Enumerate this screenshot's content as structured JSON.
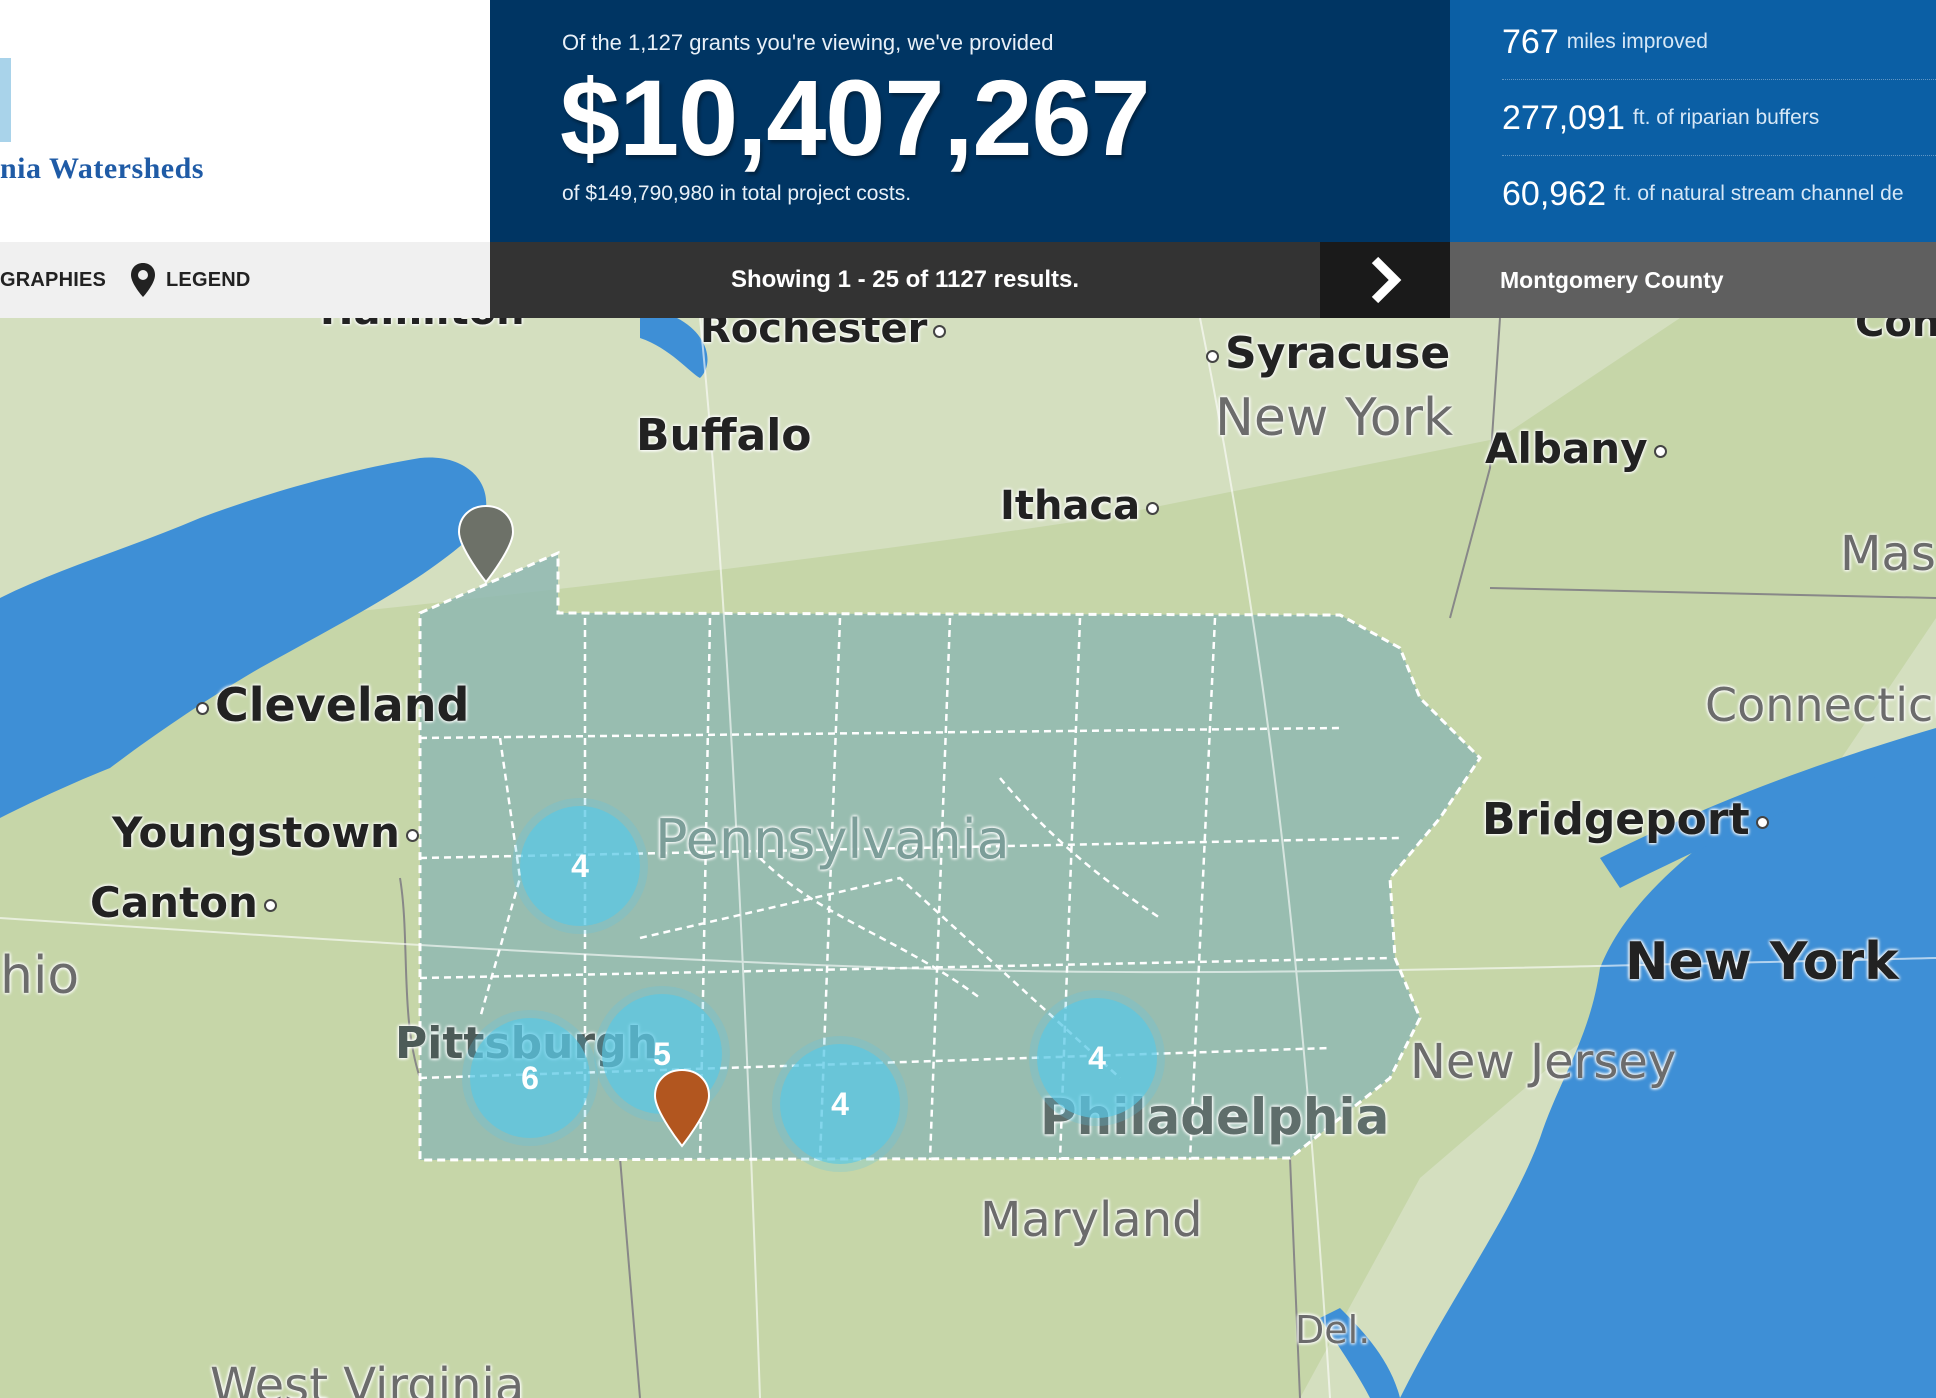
{
  "brand": {
    "logo_text": "nia Watersheds"
  },
  "nav": {
    "geographies": "GRAPHIES",
    "legend": "LEGEND"
  },
  "summary": {
    "lead": "Of the 1,127 grants you're viewing, we've provided",
    "amount": "$10,407,267",
    "total": "of $149,790,980 in total project costs."
  },
  "results": {
    "text": "Showing 1 - 25 of 1127 results."
  },
  "stats": [
    {
      "value": "767",
      "label": "miles improved"
    },
    {
      "value": "277,091",
      "label": "ft. of riparian buffers"
    },
    {
      "value": "60,962",
      "label": "ft. of natural stream channel de"
    }
  ],
  "geography": {
    "selected": "Montgomery County"
  },
  "map": {
    "cities": {
      "hamilton": "Hamilton",
      "rochester": "Rochester",
      "syracuse": "Syracuse",
      "buffalo": "Buffalo",
      "albany": "Albany",
      "ithaca": "Ithaca",
      "cleveland": "Cleveland",
      "youngstown": "Youngstown",
      "canton": "Canton",
      "pittsburgh": "Pittsburgh",
      "bridgeport": "Bridgeport",
      "philadelphia": "Philadelphia",
      "new_york_city": "New York",
      "con": "Con"
    },
    "states": {
      "new_york": "New York",
      "massachusetts": "Mas",
      "connecticut": "Connecticu",
      "pennsylvania": "Pennsylvania",
      "ohio": "hio",
      "new_jersey": "New Jersey",
      "maryland": "Maryland",
      "delaware": "Del.",
      "west_virginia": "West Virginia"
    },
    "clusters": [
      "4",
      "5",
      "6",
      "4",
      "4"
    ],
    "colors": {
      "water": "#3e8fd6",
      "land": "#d4dfbf",
      "pennsylvania_overlay": "#8fb8b2",
      "cluster": "#5ac8e6",
      "marker_gray": "#6d7168",
      "marker_orange": "#b2561f"
    }
  }
}
